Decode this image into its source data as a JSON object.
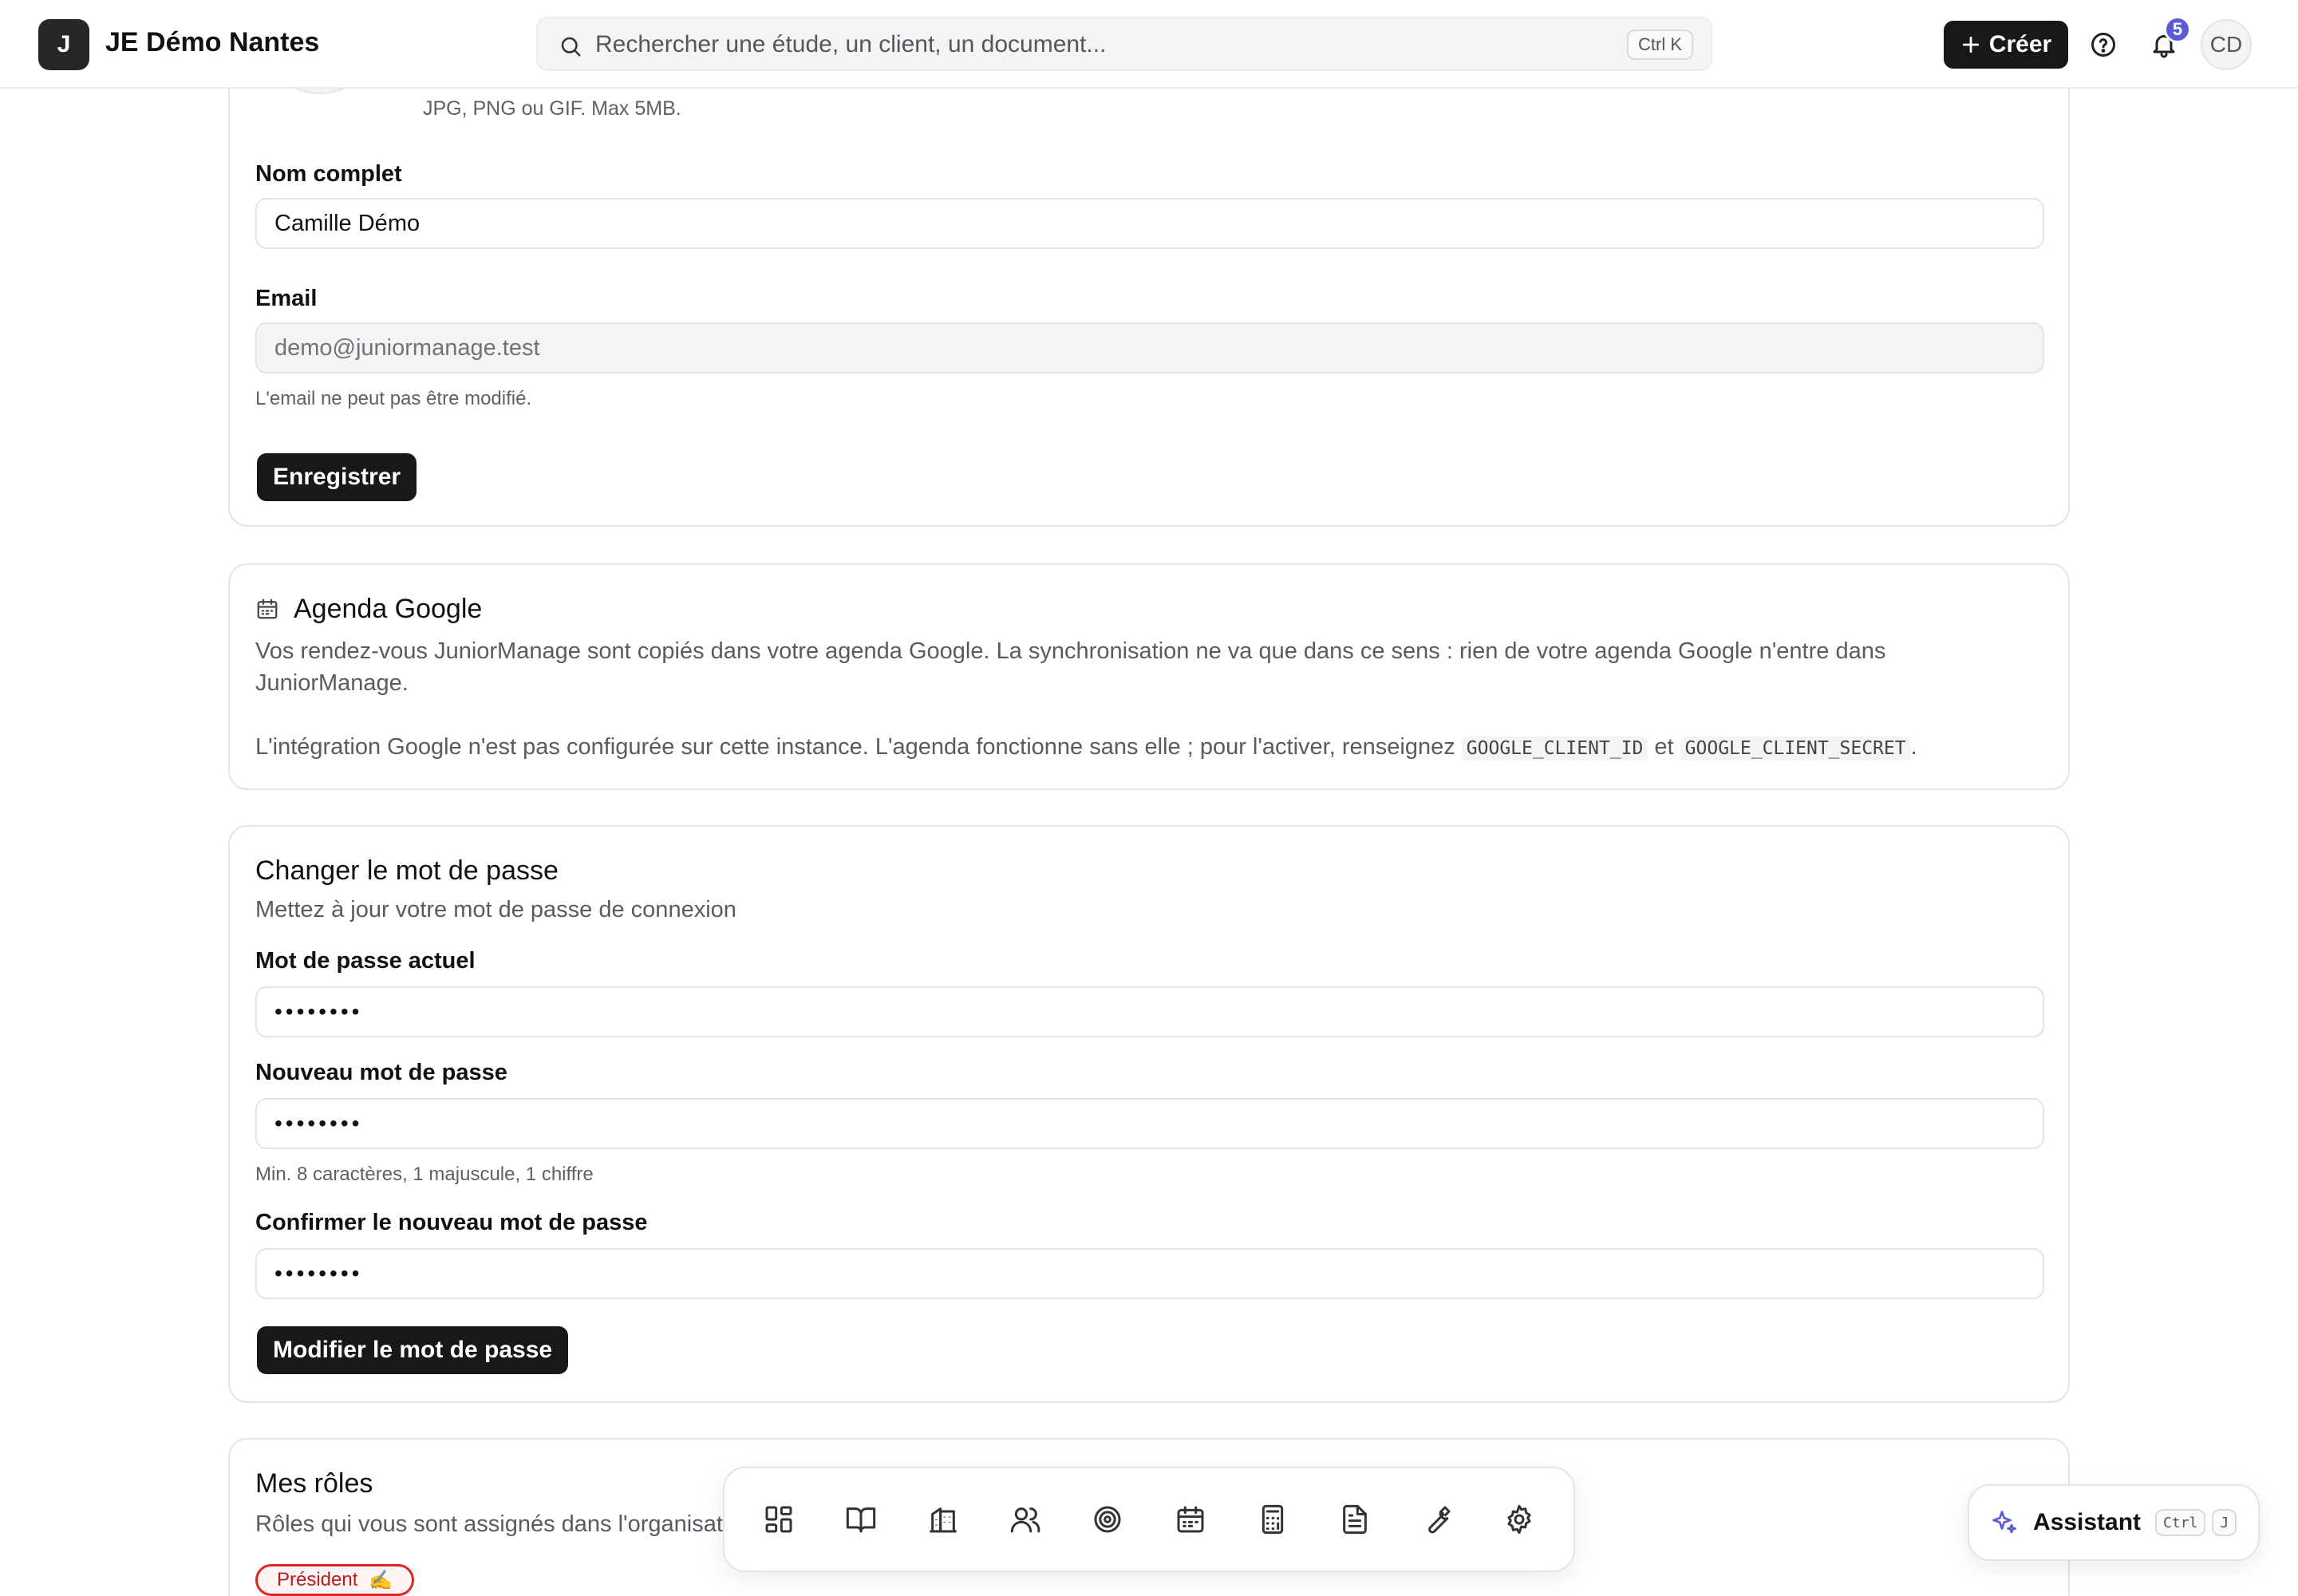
{
  "header": {
    "logo_letter": "J",
    "org_name": "JE Démo Nantes",
    "search_placeholder": "Rechercher une étude, un client, un document...",
    "search_shortcut": "Ctrl K",
    "create_label": "Créer",
    "notification_count": "5",
    "user_initials": "CD"
  },
  "profile": {
    "avatar_hint": "JPG, PNG ou GIF. Max 5MB.",
    "name_label": "Nom complet",
    "name_value": "Camille Démo",
    "email_label": "Email",
    "email_value": "demo@juniormanage.test",
    "email_help": "L'email ne peut pas être modifié.",
    "save_label": "Enregistrer"
  },
  "google": {
    "title": "Agenda Google",
    "description": "Vos rendez-vous JuniorManage sont copiés dans votre agenda Google. La synchronisation ne va que dans ce sens : rien de votre agenda Google n'entre dans JuniorManage.",
    "notice_prefix": "L'intégration Google n'est pas configurée sur cette instance. L'agenda fonctionne sans elle ; pour l'activer, renseignez",
    "code_client_id": "GOOGLE_CLIENT_ID",
    "notice_and": "et",
    "code_client_secret": "GOOGLE_CLIENT_SECRET",
    "notice_suffix": "."
  },
  "password": {
    "title": "Changer le mot de passe",
    "subtitle": "Mettez à jour votre mot de passe de connexion",
    "current_label": "Mot de passe actuel",
    "current_value": "••••••••",
    "new_label": "Nouveau mot de passe",
    "new_value": "••••••••",
    "new_help": "Min. 8 caractères, 1 majuscule, 1 chiffre",
    "confirm_label": "Confirmer le nouveau mot de passe",
    "confirm_value": "••••••••",
    "submit_label": "Modifier le mot de passe"
  },
  "roles": {
    "title": "Mes rôles",
    "subtitle": "Rôles qui vous sont assignés dans l'organisation",
    "badges": [
      {
        "label": "Président",
        "emoji": "✍️"
      }
    ]
  },
  "dock": {
    "items": [
      "dashboard-icon",
      "book-icon",
      "building-icon",
      "users-icon",
      "target-icon",
      "calendar-icon",
      "calculator-icon",
      "document-icon",
      "wrench-icon",
      "settings-icon"
    ]
  },
  "assistant": {
    "label": "Assistant",
    "shortcut_ctrl": "Ctrl",
    "shortcut_key": "J"
  },
  "colors": {
    "primary_dark": "#18181b",
    "accent_badge": "#5b5bd6",
    "role_red": "#dc2626",
    "border": "#e4e4e7"
  }
}
